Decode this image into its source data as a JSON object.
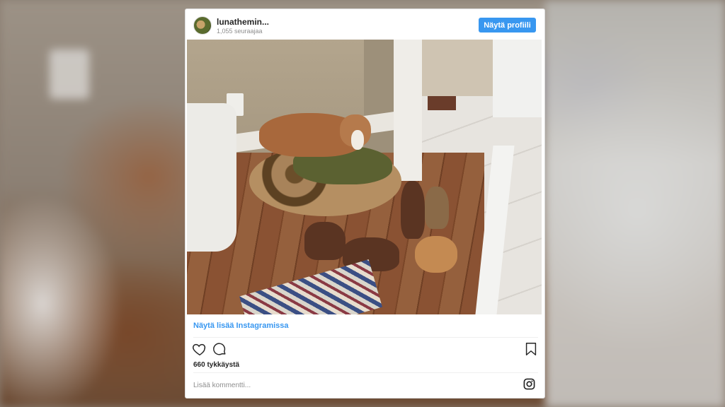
{
  "post": {
    "username": "lunathemin...",
    "followers": "1,055 seuraajaa",
    "profile_button": "Näytä profiili",
    "photo_alt": "",
    "more_link": "Näytä lisää Instagramissa",
    "likes": "660 tykkäystä",
    "comment_placeholder": "Lisää kommentti..."
  },
  "colors": {
    "accent": "#3897f0",
    "text": "#262626",
    "muted": "#8e8e8e"
  },
  "icons": [
    "heart-icon",
    "comment-icon",
    "bookmark-icon",
    "instagram-icon"
  ]
}
